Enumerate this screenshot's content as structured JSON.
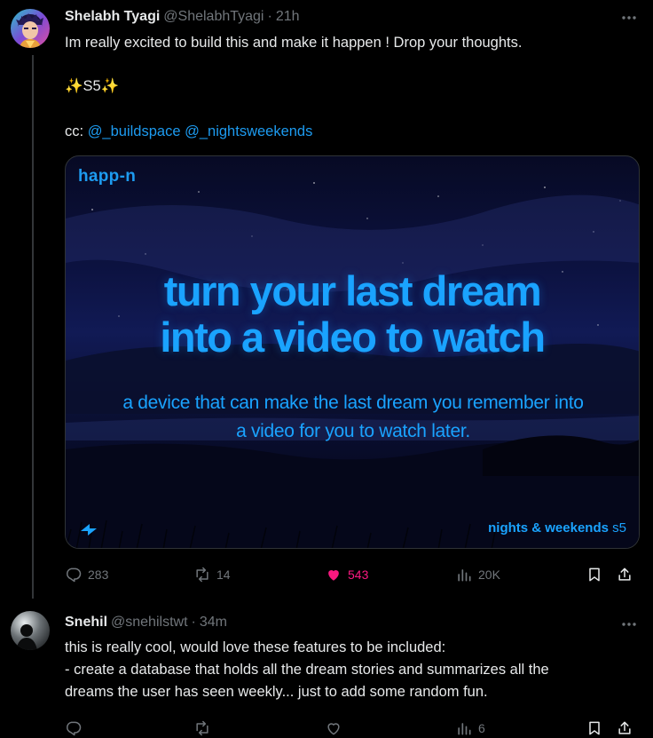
{
  "tweets": [
    {
      "name": "Shelabh Tyagi",
      "handle": "@ShelabhTyagi",
      "separator": "·",
      "time": "21h",
      "lines": [
        "Im really excited to build this and make it happen ! Drop your thoughts.",
        "✨S5✨"
      ],
      "cc_label": "cc:",
      "mentions": [
        "@_buildspace",
        "@_nightsweekends"
      ],
      "media": {
        "brand": "happ-n",
        "headline": [
          "turn your last dream",
          "into a video to watch"
        ],
        "subline": [
          "a device that can make the last dream you remember into",
          "a video for you to watch later."
        ],
        "footer_brand": "nights & weekends",
        "footer_season": "s5"
      },
      "stats": {
        "replies": "283",
        "retweets": "14",
        "likes": "543",
        "views": "20K"
      },
      "liked": true
    },
    {
      "name": "Snehil",
      "handle": "@snehilstwt",
      "separator": "·",
      "time": "34m",
      "lines": [
        "this is really cool, would love these features to be included:",
        "- create a database that holds all the dream stories and summarizes all the",
        "dreams the user has seen weekly... just to add some random fun."
      ],
      "stats": {
        "replies": "",
        "retweets": "",
        "likes": "",
        "views": "6"
      },
      "liked": false
    }
  ],
  "icons": {
    "reply": "reply-icon",
    "retweet": "retweet-icon",
    "like": "heart-icon",
    "views": "views-icon",
    "bookmark": "bookmark-icon",
    "share": "share-icon",
    "more": "more-icon"
  },
  "colors": {
    "accent": "#1d9bf0",
    "like": "#f91880",
    "muted": "#71767b",
    "text": "#e7e9ea",
    "background": "#000000"
  }
}
